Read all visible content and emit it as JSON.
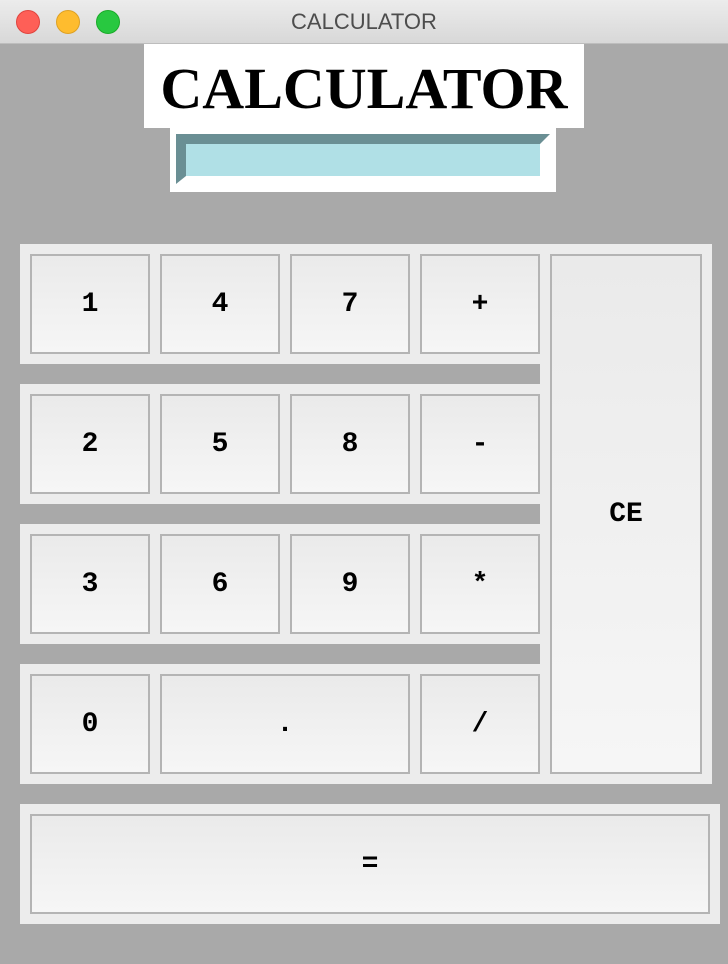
{
  "window": {
    "title": "CALCULATOR"
  },
  "app": {
    "heading": "CALCULATOR"
  },
  "display": {
    "value": ""
  },
  "keys": {
    "k1": "1",
    "k4": "4",
    "k7": "7",
    "plus": "+",
    "k2": "2",
    "k5": "5",
    "k8": "8",
    "minus": "-",
    "k3": "3",
    "k6": "6",
    "k9": "9",
    "multiply": "*",
    "k0": "0",
    "decimal": ".",
    "divide": "/",
    "clear": "CE",
    "equals": "="
  }
}
